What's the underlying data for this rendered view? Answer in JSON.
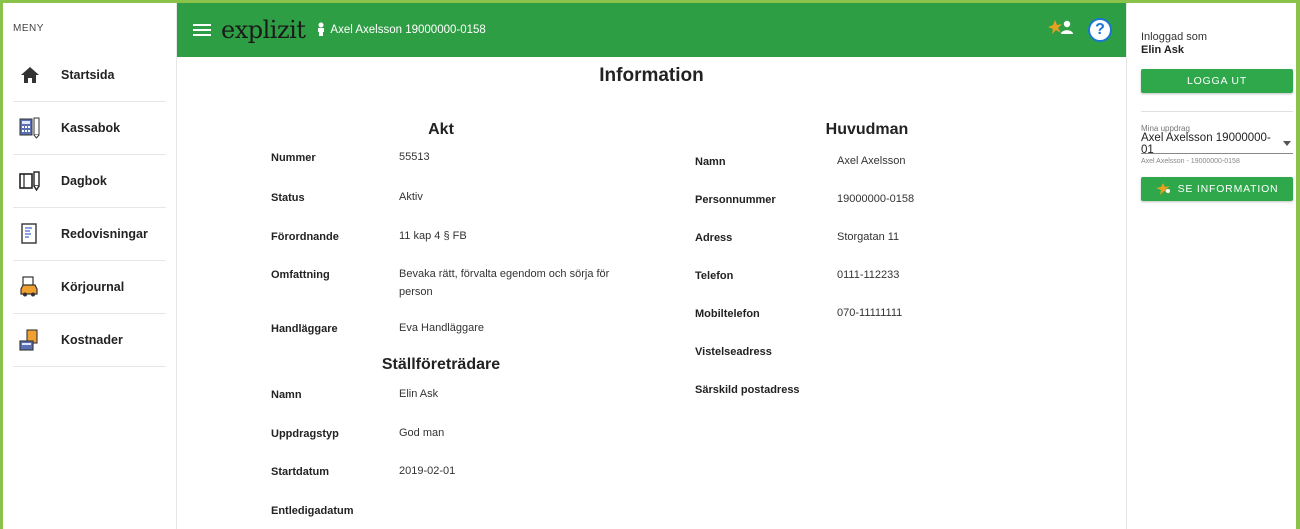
{
  "sidebar": {
    "title": "MENY",
    "items": [
      {
        "label": "Startsida",
        "icon": "home-icon"
      },
      {
        "label": "Kassabok",
        "icon": "cashbook-icon"
      },
      {
        "label": "Dagbok",
        "icon": "diary-icon"
      },
      {
        "label": "Redovisningar",
        "icon": "report-icon"
      },
      {
        "label": "Körjournal",
        "icon": "car-icon"
      },
      {
        "label": "Kostnader",
        "icon": "costs-icon"
      }
    ]
  },
  "topbar": {
    "logo": "explizit",
    "client": "Axel Axelsson 19000000-0158",
    "help_label": "?"
  },
  "page": {
    "title": "Information",
    "akt": {
      "heading": "Akt",
      "rows": [
        {
          "label": "Nummer",
          "value": "55513"
        },
        {
          "label": "Status",
          "value": "Aktiv"
        },
        {
          "label": "Förordnande",
          "value": "11 kap 4 § FB"
        },
        {
          "label": "Omfattning",
          "value": "Bevaka rätt, förvalta egendom och sörja för person"
        },
        {
          "label": "Handläggare",
          "value": "Eva Handläggare"
        }
      ]
    },
    "stallforetradare": {
      "heading": "Ställföreträdare",
      "rows": [
        {
          "label": "Namn",
          "value": "Elin Ask"
        },
        {
          "label": "Uppdragstyp",
          "value": "God man"
        },
        {
          "label": "Startdatum",
          "value": "2019-02-01"
        },
        {
          "label": "Entledigadatum",
          "value": ""
        }
      ]
    },
    "huvudman": {
      "heading": "Huvudman",
      "rows": [
        {
          "label": "Namn",
          "value": "Axel Axelsson"
        },
        {
          "label": "Personnummer",
          "value": "19000000-0158"
        },
        {
          "label": "Adress",
          "value": "Storgatan 11"
        },
        {
          "label": "Telefon",
          "value": "0111-112233"
        },
        {
          "label": "Mobiltelefon",
          "value": "070-11111111"
        },
        {
          "label": "Vistelseadress",
          "value": ""
        },
        {
          "label": "Särskild postadress",
          "value": ""
        }
      ]
    }
  },
  "rightpanel": {
    "logged_in_label": "Inloggad som",
    "logged_in_name": "Elin Ask",
    "logout_label": "LOGGA UT",
    "assignments_label": "Mina uppdrag",
    "assignment_selected": "Axel Axelsson 19000000-01",
    "assignment_helper": "Axel Axelsson - 19000000-0158",
    "info_button_label": "SE INFORMATION"
  },
  "colors": {
    "accent_green": "#2e9e44",
    "button_green": "#2ea84a",
    "frame_green": "#8bc34a",
    "help_blue": "#1976d2"
  }
}
